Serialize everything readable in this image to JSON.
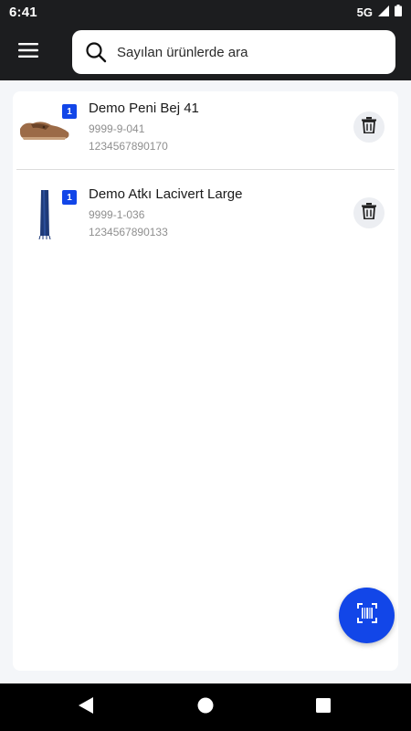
{
  "status_bar": {
    "time": "6:41",
    "network": "5G"
  },
  "header": {
    "search_placeholder": "Sayılan ürünlerde ara"
  },
  "items": [
    {
      "name": "Demo Peni Bej 41",
      "code": "9999-9-041",
      "barcode": "1234567890170",
      "quantity": "1",
      "image": "shoe-image"
    },
    {
      "name": "Demo Atkı Lacivert Large",
      "code": "9999-1-036",
      "barcode": "1234567890133",
      "quantity": "1",
      "image": "scarf-image"
    }
  ],
  "icons": {
    "menu": "menu-icon",
    "search": "search-icon",
    "delete": "trash-icon",
    "scan": "barcode-scan-icon",
    "nav_back": "back-icon",
    "nav_home": "home-icon",
    "nav_recents": "recents-icon"
  },
  "colors": {
    "accent": "#1246e8",
    "app_bar": "#1c1d1f",
    "background": "#f4f6f9"
  }
}
